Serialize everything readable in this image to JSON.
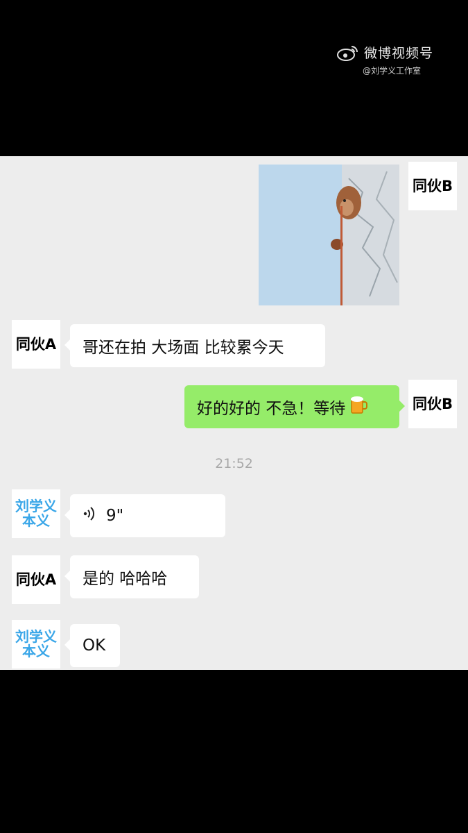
{
  "watermark": {
    "title": "微博视频号",
    "subtitle": "@刘学义工作室"
  },
  "chat": {
    "timestamp": "21:52",
    "avatars": {
      "b": "同伙B",
      "a": "同伙A",
      "liu_line1": "刘学义",
      "liu_line2": "本义"
    },
    "messages": [
      {
        "sender": "同伙B",
        "type": "sticker"
      },
      {
        "sender": "同伙A",
        "text": "哥还在拍  大场面 比较累今天"
      },
      {
        "sender": "同伙B",
        "text": "好的好的 不急！等待"
      },
      {
        "sender": "刘学义本义",
        "type": "voice",
        "text": "9\""
      },
      {
        "sender": "同伙A",
        "text": "是的 哈哈哈"
      },
      {
        "sender": "刘学义本义",
        "text": "OK"
      }
    ]
  },
  "colors": {
    "chat_bg": "#ededed",
    "green_bubble": "#95ec69",
    "avatar_blue_text": "#39a6e8"
  },
  "icons": [
    "weibo-logo-icon",
    "voice-wave-icon",
    "beer-emoji-icon"
  ]
}
